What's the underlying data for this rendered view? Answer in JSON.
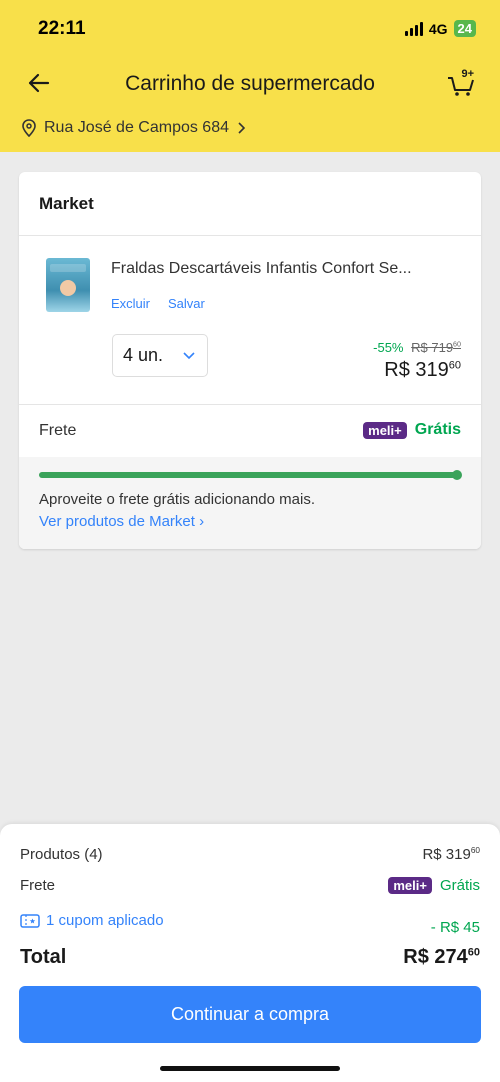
{
  "status_bar": {
    "time": "22:11",
    "network": "4G",
    "battery": "24"
  },
  "header": {
    "title": "Carrinho de supermercado",
    "cart_count": "9+"
  },
  "address": {
    "text": "Rua José de Campos 684"
  },
  "store": {
    "name": "Market",
    "item": {
      "name": "Fraldas Descartáveis Infantis Confort Se...",
      "delete_label": "Excluir",
      "save_label": "Salvar",
      "quantity": "4 un.",
      "discount": "-55%",
      "old_price": "R$ 719",
      "old_price_cents": "60",
      "price": "R$ 319",
      "price_cents": "60"
    },
    "shipping": {
      "label": "Frete",
      "badge": "meli+",
      "value": "Grátis",
      "progress": 1.0,
      "message": "Aproveite o frete grátis adicionando mais.",
      "link": "Ver produtos de Market"
    }
  },
  "summary": {
    "products_label": "Produtos (4)",
    "products_value": "R$ 319",
    "products_cents": "60",
    "shipping_label": "Frete",
    "shipping_badge": "meli+",
    "shipping_value": "Grátis",
    "coupon_label": "1 cupom aplicado",
    "coupon_value": "- R$ 45",
    "total_label": "Total",
    "total_value": "R$ 274",
    "total_cents": "60",
    "cta": "Continuar a compra"
  },
  "colors": {
    "header": "#f8e04a",
    "accent": "#3483fa",
    "success": "#00a650",
    "meli": "#5b2a86"
  }
}
